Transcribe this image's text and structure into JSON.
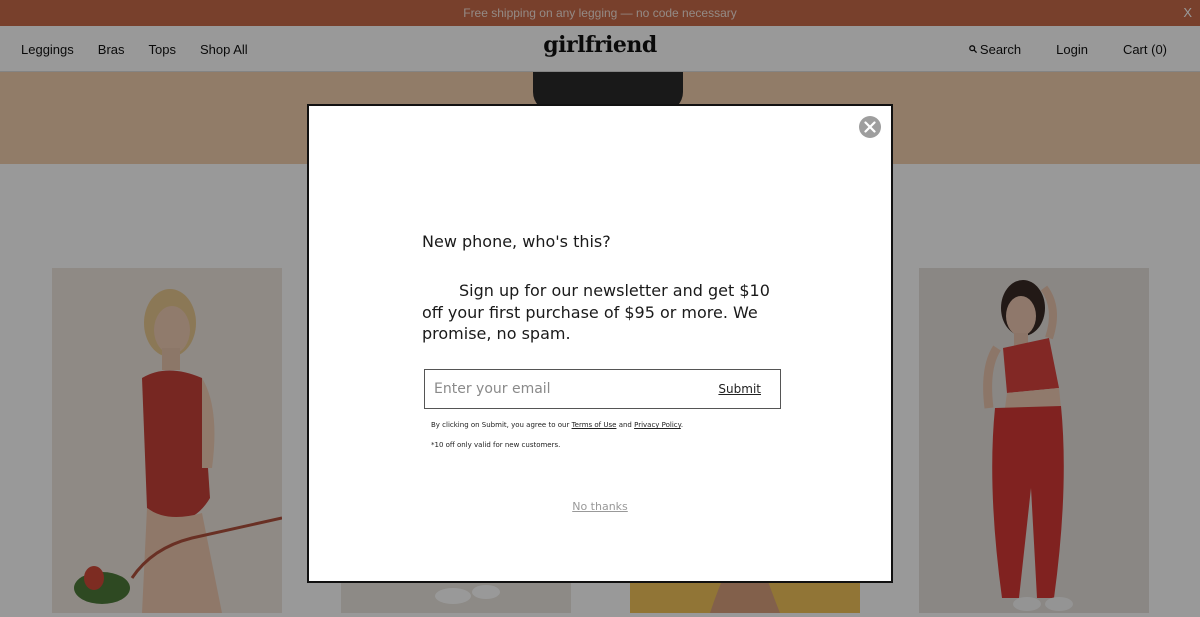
{
  "announcement": {
    "text": "Free shipping on any legging — no code necessary",
    "close_label": "X"
  },
  "nav": {
    "links": [
      "Leggings",
      "Bras",
      "Tops",
      "Shop All"
    ],
    "brand": "girlfriend",
    "search_label": "Search",
    "login_label": "Login",
    "cart_label": "Cart (0)"
  },
  "modal": {
    "title": "New phone, who's this?",
    "body": "Sign up for our newsletter and get $10 off your first purchase of $95 or more. We promise, no spam.",
    "email_placeholder": "Enter your email",
    "submit_label": "Submit",
    "legal_prefix": "By clicking on Submit, you agree to our",
    "terms_label": "Terms of Use",
    "legal_and": "and",
    "privacy_label": "Privacy Policy",
    "legal_suffix": ".",
    "footnote": "*10 off only valid for new customers.",
    "no_thanks_label": "No thanks",
    "close_icon": "close-icon"
  },
  "colors": {
    "announcement_bg": "#c96b4a",
    "hero_bg": "#f2cfae",
    "overlay": "rgba(0,0,0,0.40)",
    "modal_border": "#111111",
    "no_thanks": "#999999"
  }
}
